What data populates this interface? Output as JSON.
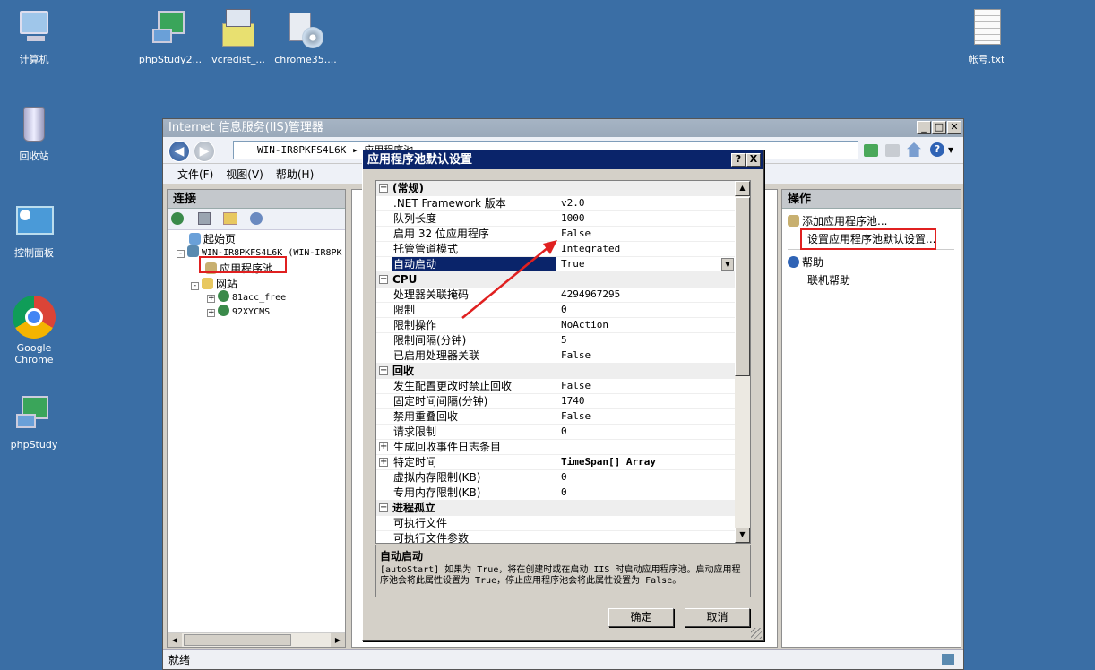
{
  "desktop": {
    "icons": [
      {
        "label": "计算机"
      },
      {
        "label": "phpStudy2..."
      },
      {
        "label": "vcredist_..."
      },
      {
        "label": "chrome35...."
      },
      {
        "label": "帐号.txt"
      },
      {
        "label": "回收站"
      },
      {
        "label": "控制面板"
      },
      {
        "label": "Google Chrome"
      },
      {
        "label": "phpStudy"
      }
    ]
  },
  "iis": {
    "title": "Internet 信息服务(IIS)管理器",
    "address": "WIN-IR8PKFS4L6K ▸ 应用程序池",
    "menu": [
      "文件(F)",
      "视图(V)",
      "帮助(H)"
    ],
    "connections_title": "连接",
    "tree": [
      {
        "label": "起始页"
      },
      {
        "label": "WIN-IR8PKFS4L6K (WIN-IR8PK"
      },
      {
        "label": "应用程序池"
      },
      {
        "label": "网站"
      },
      {
        "label": "81acc_free"
      },
      {
        "label": "92XYCMS"
      }
    ],
    "actions_title": "操作",
    "actions": [
      {
        "label": "添加应用程序池..."
      },
      {
        "label": "设置应用程序池默认设置..."
      },
      {
        "label": "帮助"
      },
      {
        "label": "联机帮助"
      }
    ],
    "status": "就绪"
  },
  "dialog": {
    "title": "应用程序池默认设置",
    "help_btn": "?",
    "close_btn": "X",
    "rows": [
      {
        "type": "group",
        "label": "(常规)",
        "exp": "-"
      },
      {
        "type": "prop",
        "key": ".NET Framework 版本",
        "value": "v2.0"
      },
      {
        "type": "prop",
        "key": "队列长度",
        "value": "1000"
      },
      {
        "type": "prop",
        "key": "启用 32 位应用程序",
        "value": "False"
      },
      {
        "type": "prop",
        "key": "托管管道模式",
        "value": "Integrated"
      },
      {
        "type": "prop",
        "key": "自动启动",
        "value": "True",
        "selected": true
      },
      {
        "type": "group",
        "label": "CPU",
        "exp": "-"
      },
      {
        "type": "prop",
        "key": "处理器关联掩码",
        "value": "4294967295"
      },
      {
        "type": "prop",
        "key": "限制",
        "value": "0"
      },
      {
        "type": "prop",
        "key": "限制操作",
        "value": "NoAction"
      },
      {
        "type": "prop",
        "key": "限制间隔(分钟)",
        "value": "5"
      },
      {
        "type": "prop",
        "key": "已启用处理器关联",
        "value": "False"
      },
      {
        "type": "group",
        "label": "回收",
        "exp": "-"
      },
      {
        "type": "prop",
        "key": "发生配置更改时禁止回收",
        "value": "False"
      },
      {
        "type": "prop",
        "key": "固定时间间隔(分钟)",
        "value": "1740"
      },
      {
        "type": "prop",
        "key": "禁用重叠回收",
        "value": "False"
      },
      {
        "type": "prop",
        "key": "请求限制",
        "value": "0"
      },
      {
        "type": "sub",
        "key": "生成回收事件日志条目",
        "value": "",
        "exp": "+"
      },
      {
        "type": "sub",
        "key": "特定时间",
        "value": "TimeSpan[] Array",
        "exp": "+",
        "bold": true
      },
      {
        "type": "prop",
        "key": "虚拟内存限制(KB)",
        "value": "0"
      },
      {
        "type": "prop",
        "key": "专用内存限制(KB)",
        "value": "0"
      },
      {
        "type": "group",
        "label": "进程孤立",
        "exp": "-"
      },
      {
        "type": "prop",
        "key": "可执行文件",
        "value": ""
      },
      {
        "type": "prop",
        "key": "可执行文件参数",
        "value": ""
      }
    ],
    "desc_title": "自动启动",
    "desc_text": "[autoStart] 如果为 True，将在创建时或在启动 IIS 时启动应用程序池。启动应用程序池会将此属性设置为 True，停止应用程序池会将此属性设置为 False。",
    "ok": "确定",
    "cancel": "取消"
  },
  "colors": {
    "desktop": "#3a6ea5",
    "selection": "#0a246a",
    "highlight_box": "#e02020"
  }
}
